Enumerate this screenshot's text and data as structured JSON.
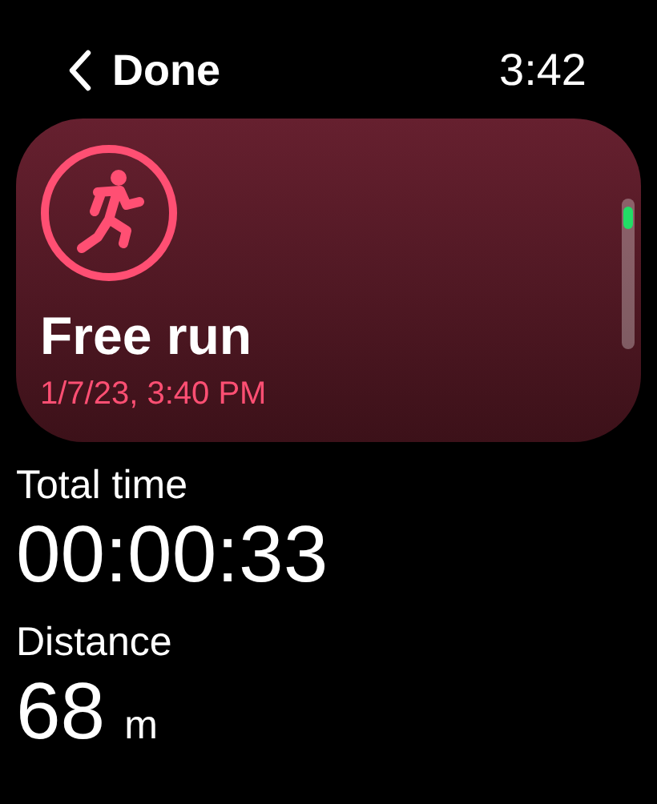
{
  "header": {
    "back_label": "Done",
    "time": "3:42"
  },
  "workout": {
    "title": "Free run",
    "date": "1/7/23, 3:40 PM"
  },
  "stats": [
    {
      "label": "Total time",
      "value": "00:00:33"
    },
    {
      "label": "Distance",
      "value": "68",
      "unit": "m"
    }
  ]
}
